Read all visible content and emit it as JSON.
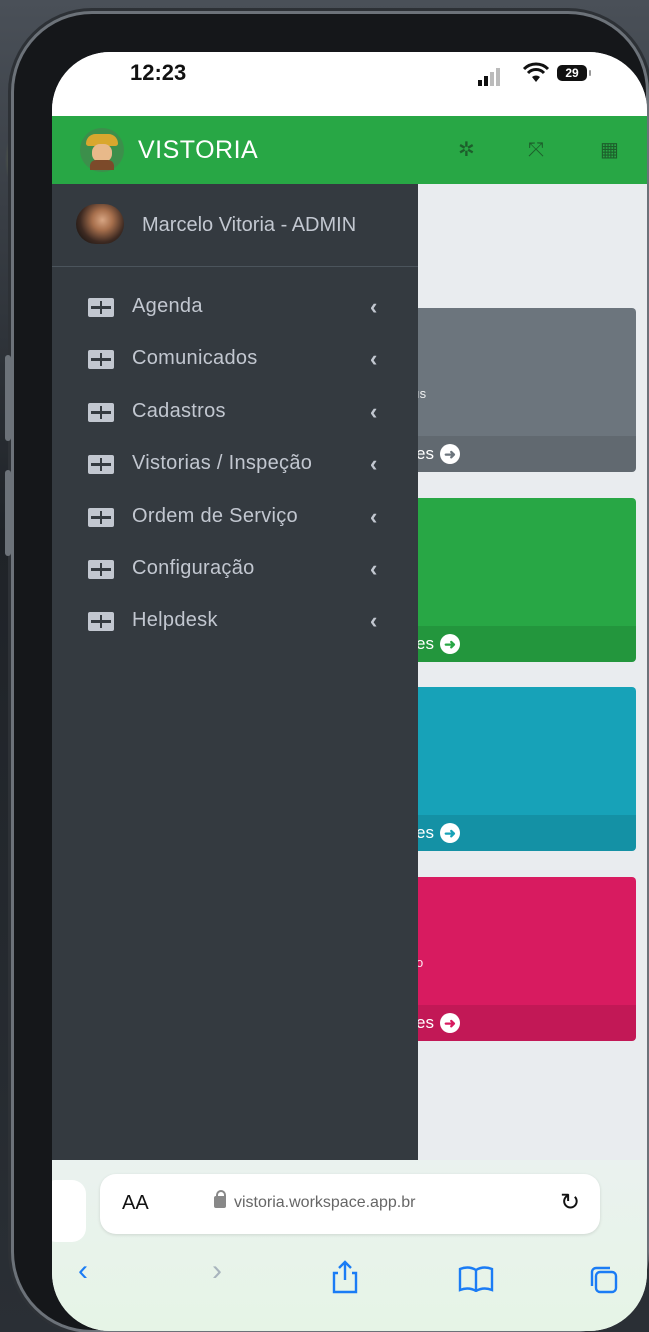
{
  "status_bar": {
    "time": "12:23",
    "battery": "29"
  },
  "sidebar": {
    "brand": "VISTORIA",
    "user_name": "Marcelo Vitoria - ADMIN",
    "items": [
      {
        "label": "Agenda"
      },
      {
        "label": "Comunicados"
      },
      {
        "label": "Cadastros"
      },
      {
        "label": "Vistorias / Inspeção"
      },
      {
        "label": "Ordem de Serviço"
      },
      {
        "label": "Configuração"
      },
      {
        "label": "Helpdesk"
      }
    ]
  },
  "topbar": {
    "icons": [
      "gear-icon",
      "compress-icon",
      "grid-icon"
    ]
  },
  "cards": [
    {
      "color": "#6c757d",
      "fragment": "ıs",
      "footer": "es"
    },
    {
      "color": "#28a745",
      "fragment": "",
      "footer": "es"
    },
    {
      "color": "#17a2b8",
      "fragment": "",
      "footer": "es"
    },
    {
      "color": "#dc3545",
      "fragment": "o",
      "footer": "es"
    }
  ],
  "browser": {
    "aa": "AA",
    "url": "vistoria.workspace.app.br"
  }
}
